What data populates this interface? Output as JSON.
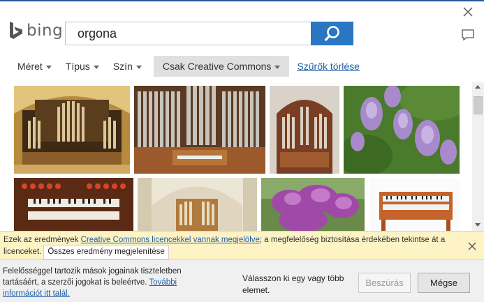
{
  "header": {
    "logo_text": "bing",
    "brand_color": "#2b5797"
  },
  "search": {
    "query": "orgona",
    "button_color": "#2a76c2",
    "icon": "search-icon"
  },
  "filters": {
    "items": [
      {
        "label": "Méret"
      },
      {
        "label": "Típus"
      },
      {
        "label": "Szín"
      },
      {
        "label": "Csak Creative Commons"
      }
    ],
    "clear_label": "Szűrők törlése"
  },
  "results": {
    "images": [
      {
        "subject": "cathedral pipe organ gold"
      },
      {
        "subject": "concert pipe organ wooden"
      },
      {
        "subject": "church organ arch"
      },
      {
        "subject": "lilac flowers"
      },
      {
        "subject": "organ console keys"
      },
      {
        "subject": "organ in white church"
      },
      {
        "subject": "lilac shrub"
      },
      {
        "subject": "hammond organ"
      }
    ]
  },
  "notice": {
    "text_before": "Ezek az eredmények ",
    "link_text": "Creative Commons licencekkel vannak megjelölve",
    "text_after": "; a megfelelőség biztosítása érdekében tekintse át a licenceket.",
    "show_all_label": "Összes eredmény megjelenítése",
    "bg_color": "#fdf3c4"
  },
  "footer": {
    "disclaimer": "Felelősséggel tartozik mások jogainak tiszteletben tartásáért, a szerzői jogokat is beleértve. ",
    "more_info_link": "További információt itt talál.",
    "select_prompt": "Válasszon ki egy vagy több elemet.",
    "insert_label": "Beszúrás",
    "cancel_label": "Mégse"
  }
}
